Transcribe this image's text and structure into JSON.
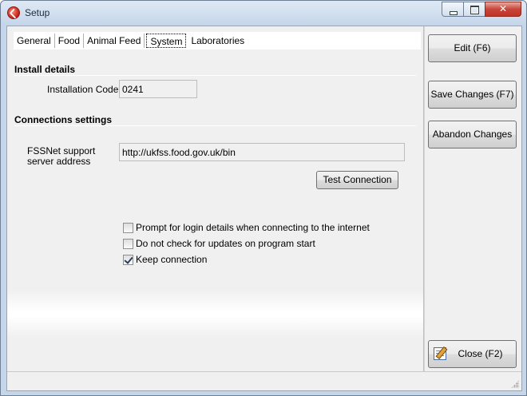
{
  "window": {
    "title": "Setup"
  },
  "tabs": [
    {
      "label": "General"
    },
    {
      "label": "Food"
    },
    {
      "label": "Animal Feed"
    },
    {
      "label": "System"
    },
    {
      "label": "Laboratories"
    }
  ],
  "active_tab": "System",
  "install": {
    "heading": "Install details",
    "code_label": "Installation Code:",
    "code_value": "0241"
  },
  "connections": {
    "heading": "Connections settings",
    "server_label": "FSSNet support server address",
    "server_value": "http://ukfss.food.gov.uk/bin",
    "test_button": "Test Connection"
  },
  "options": [
    {
      "label": "Prompt for login details when connecting to the internet",
      "checked": false
    },
    {
      "label": "Do not check for updates on program start",
      "checked": false
    },
    {
      "label": "Keep connection",
      "checked": true
    }
  ],
  "sidebar": {
    "edit": "Edit (F6)",
    "save": "Save Changes (F7)",
    "abandon": "Abandon Changes",
    "close": "Close (F2)"
  }
}
